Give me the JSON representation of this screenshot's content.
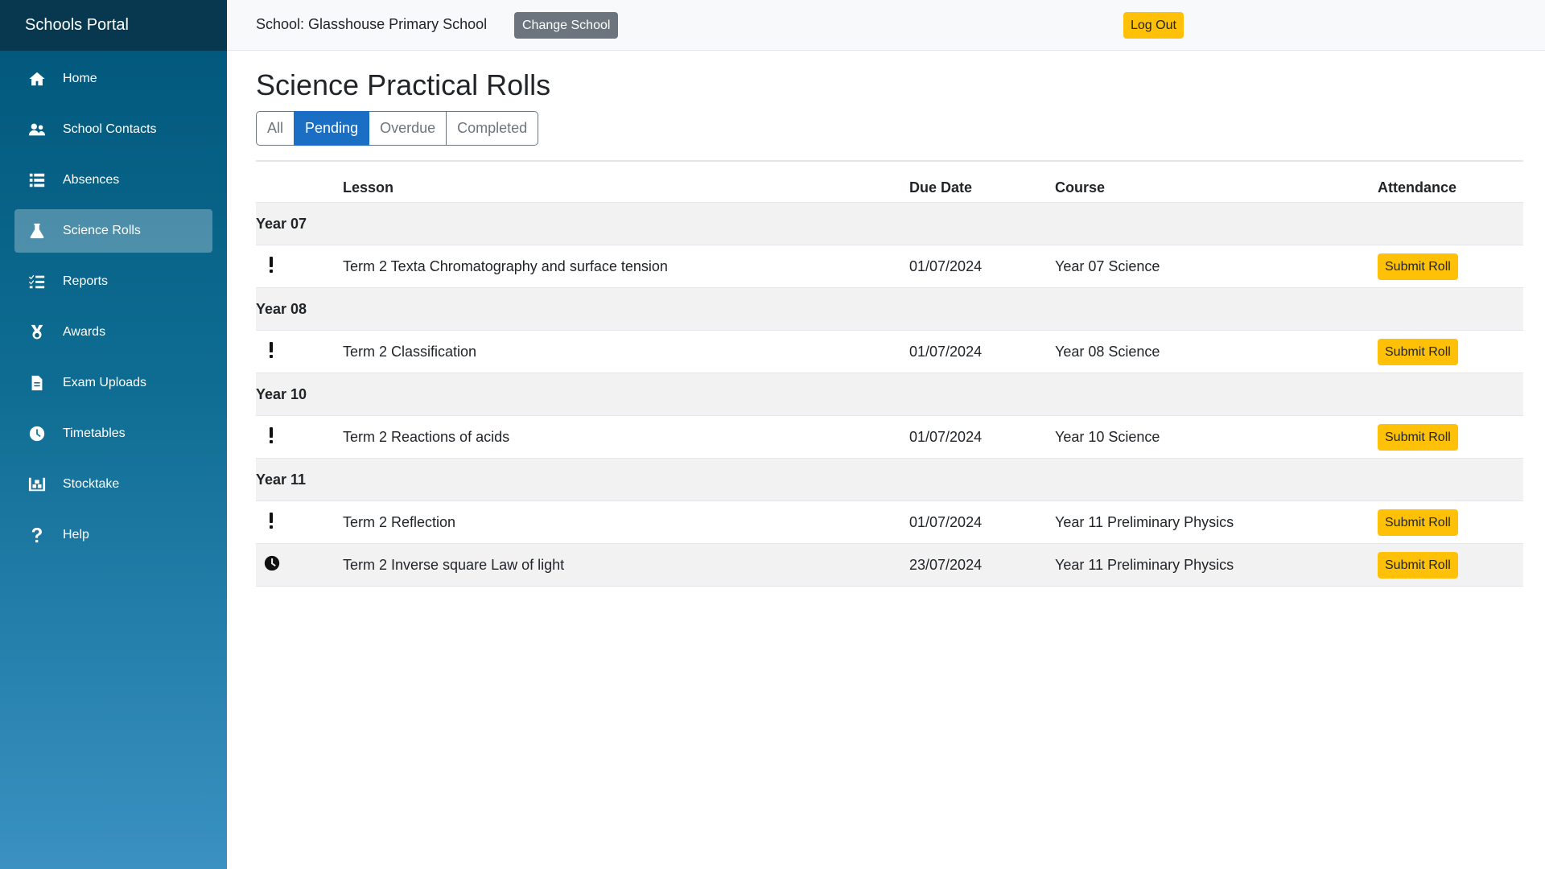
{
  "app": {
    "brand": "Schools Portal"
  },
  "sidebar": {
    "items": [
      {
        "label": "Home",
        "icon": "home-icon",
        "active": false
      },
      {
        "label": "School Contacts",
        "icon": "users-icon",
        "active": false
      },
      {
        "label": "Absences",
        "icon": "list-icon",
        "active": false
      },
      {
        "label": "Science Rolls",
        "icon": "flask-icon",
        "active": true
      },
      {
        "label": "Reports",
        "icon": "checklist-icon",
        "active": false
      },
      {
        "label": "Awards",
        "icon": "medal-icon",
        "active": false
      },
      {
        "label": "Exam Uploads",
        "icon": "file-icon",
        "active": false
      },
      {
        "label": "Timetables",
        "icon": "clock-icon",
        "active": false
      },
      {
        "label": "Stocktake",
        "icon": "warehouse-icon",
        "active": false
      },
      {
        "label": "Help",
        "icon": "question-icon",
        "active": false
      }
    ]
  },
  "topbar": {
    "school_label": "School: Glasshouse Primary School",
    "change_school": "Change School",
    "logout": "Log Out"
  },
  "page": {
    "title": "Science Practical Rolls",
    "filters": [
      "All",
      "Pending",
      "Overdue",
      "Completed"
    ],
    "active_filter": "Pending"
  },
  "table": {
    "headers": {
      "status": "",
      "lesson": "Lesson",
      "due": "Due Date",
      "course": "Course",
      "attendance": "Attendance"
    },
    "groups": [
      {
        "name": "Year 07",
        "rows": [
          {
            "status": "exclamation-icon",
            "lesson": "Term 2 Texta Chromatography and surface tension",
            "due": "01/07/2024",
            "course": "Year 07 Science",
            "action": "Submit Roll"
          }
        ]
      },
      {
        "name": "Year 08",
        "rows": [
          {
            "status": "exclamation-icon",
            "lesson": "Term 2 Classification",
            "due": "01/07/2024",
            "course": "Year 08 Science",
            "action": "Submit Roll"
          }
        ]
      },
      {
        "name": "Year 10",
        "rows": [
          {
            "status": "exclamation-icon",
            "lesson": "Term 2 Reactions of acids",
            "due": "01/07/2024",
            "course": "Year 10 Science",
            "action": "Submit Roll"
          }
        ]
      },
      {
        "name": "Year 11",
        "rows": [
          {
            "status": "exclamation-icon",
            "lesson": "Term 2 Reflection",
            "due": "01/07/2024",
            "course": "Year 11 Preliminary Physics",
            "action": "Submit Roll"
          },
          {
            "status": "clock-icon",
            "lesson": "Term 2 Inverse square Law of light",
            "due": "23/07/2024",
            "course": "Year 11 Preliminary Physics",
            "action": "Submit Roll"
          }
        ]
      }
    ]
  },
  "colors": {
    "sidebar_top": "#00567a",
    "sidebar_bottom": "#3a91c2",
    "brand_bar": "#07384f",
    "primary": "#1a6fc4",
    "warning": "#ffc107",
    "secondary": "#6c757d"
  }
}
